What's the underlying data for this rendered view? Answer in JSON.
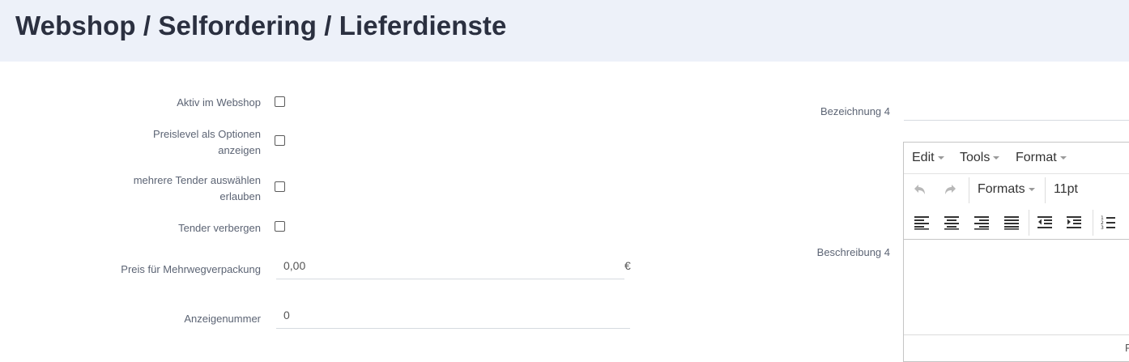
{
  "header": {
    "title": "Webshop / Selfordering / Lieferdienste"
  },
  "form": {
    "aktiv_label": "Aktiv im Webshop",
    "preislevel_label": "Preislevel als Optionen\nanzeigen",
    "tender_multi_label": "mehrere Tender auswählen\nerlauben",
    "tender_hide_label": "Tender verbergen",
    "preis_label": "Preis für Mehrwegverpackung",
    "preis_value": "0,00",
    "preis_unit": "€",
    "anzeige_label": "Anzeigenummer",
    "anzeige_value": "0"
  },
  "right": {
    "bezeichnung_label": "Bezeichnung 4",
    "beschreibung_label": "Beschreibung 4"
  },
  "editor": {
    "menu": {
      "edit": "Edit",
      "tools": "Tools",
      "format": "Format"
    },
    "formats_label": "Formats",
    "font_size": "11pt",
    "status_char": "F",
    "icons": [
      "undo-icon",
      "redo-icon",
      "align-left-icon",
      "align-center-icon",
      "align-right-icon",
      "align-justify-icon",
      "outdent-icon",
      "indent-icon",
      "numbered-list-icon"
    ]
  }
}
